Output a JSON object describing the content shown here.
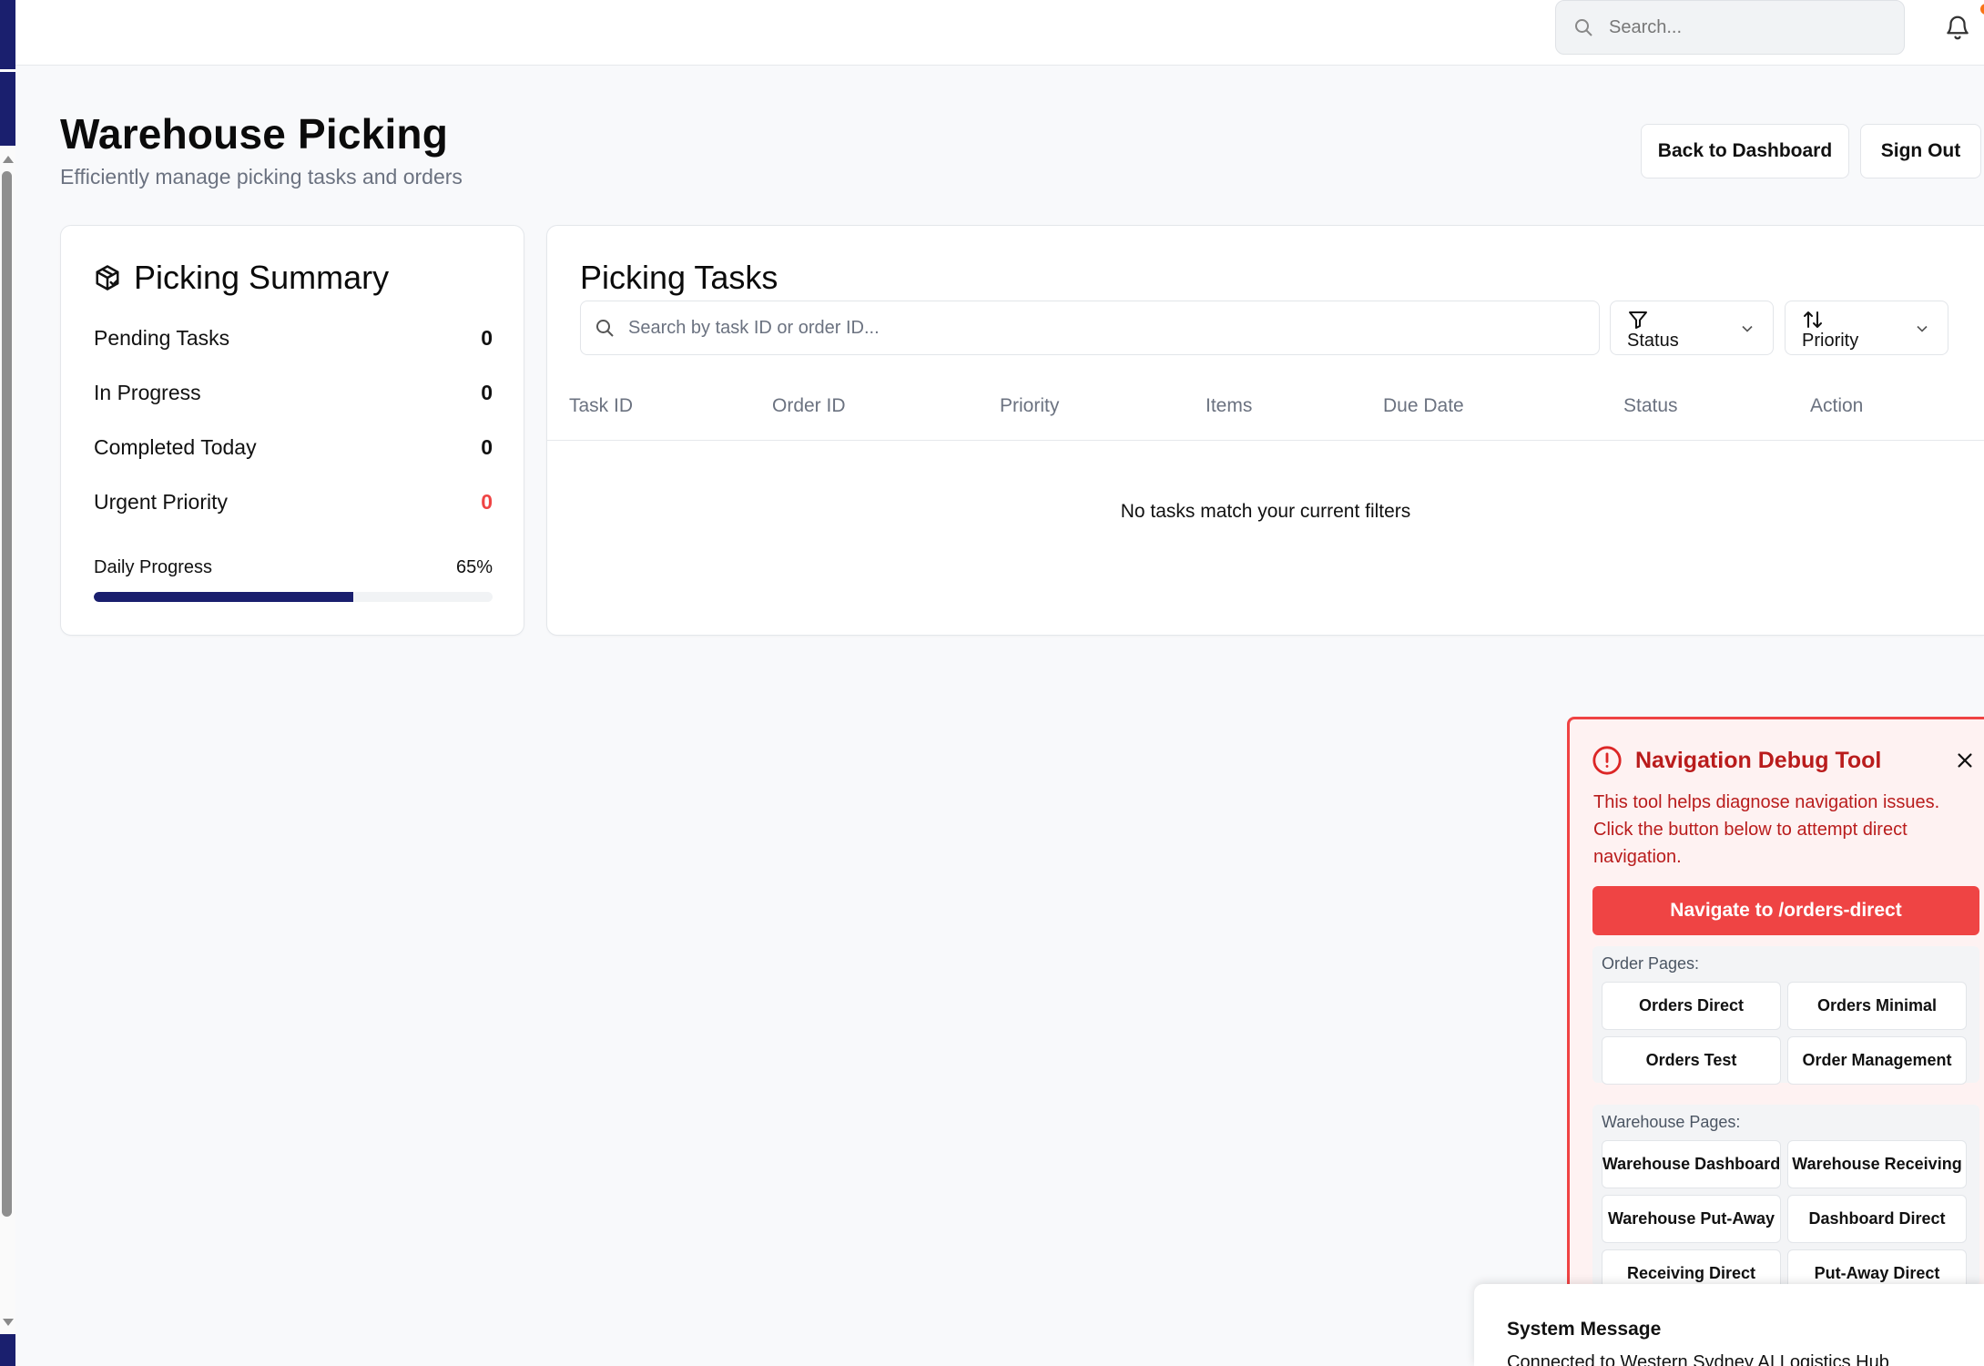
{
  "topbar": {
    "search_placeholder": "Search...",
    "search_icon": "search-icon",
    "bell_icon": "bell-icon",
    "notification_dot_color": "#f97316"
  },
  "header": {
    "title": "Warehouse Picking",
    "subtitle": "Efficiently manage picking tasks and orders",
    "back_label": "Back to Dashboard",
    "signout_label": "Sign Out"
  },
  "summary": {
    "title": "Picking Summary",
    "icon": "package-check-icon",
    "stats": [
      {
        "label": "Pending Tasks",
        "value": "0"
      },
      {
        "label": "In Progress",
        "value": "0"
      },
      {
        "label": "Completed Today",
        "value": "0"
      },
      {
        "label": "Urgent Priority",
        "value": "0",
        "color": "#ef4444"
      }
    ],
    "progress_label": "Daily Progress",
    "progress_text": "65%",
    "progress_value": 0.65,
    "progress_color": "#1a1f6e"
  },
  "tasks": {
    "title": "Picking Tasks",
    "search_placeholder": "Search by task ID or order ID...",
    "status_filter": "Status",
    "priority_sort": "Priority",
    "columns": [
      "Task ID",
      "Order ID",
      "Priority",
      "Items",
      "Due Date",
      "Status",
      "Action"
    ],
    "rows": [],
    "empty_message": "No tasks match your current filters"
  },
  "debug": {
    "title": "Navigation Debug Tool",
    "description": "This tool helps diagnose navigation issues. Click the button below to attempt direct navigation.",
    "main_button": "Navigate to /orders-direct",
    "order_label": "Order Pages:",
    "order_pages": [
      "Orders Direct",
      "Orders Minimal",
      "Orders Test",
      "Order Management"
    ],
    "warehouse_label": "Warehouse Pages:",
    "warehouse_pages": [
      "Warehouse Dashboard",
      "Warehouse Receiving",
      "Warehouse Put-Away",
      "Dashboard Direct",
      "Receiving Direct",
      "Put-Away Direct"
    ],
    "accent_color": "#ef4444"
  },
  "system_message": {
    "title": "System Message",
    "text": "Connected to Western Sydney AI Logistics Hub"
  }
}
